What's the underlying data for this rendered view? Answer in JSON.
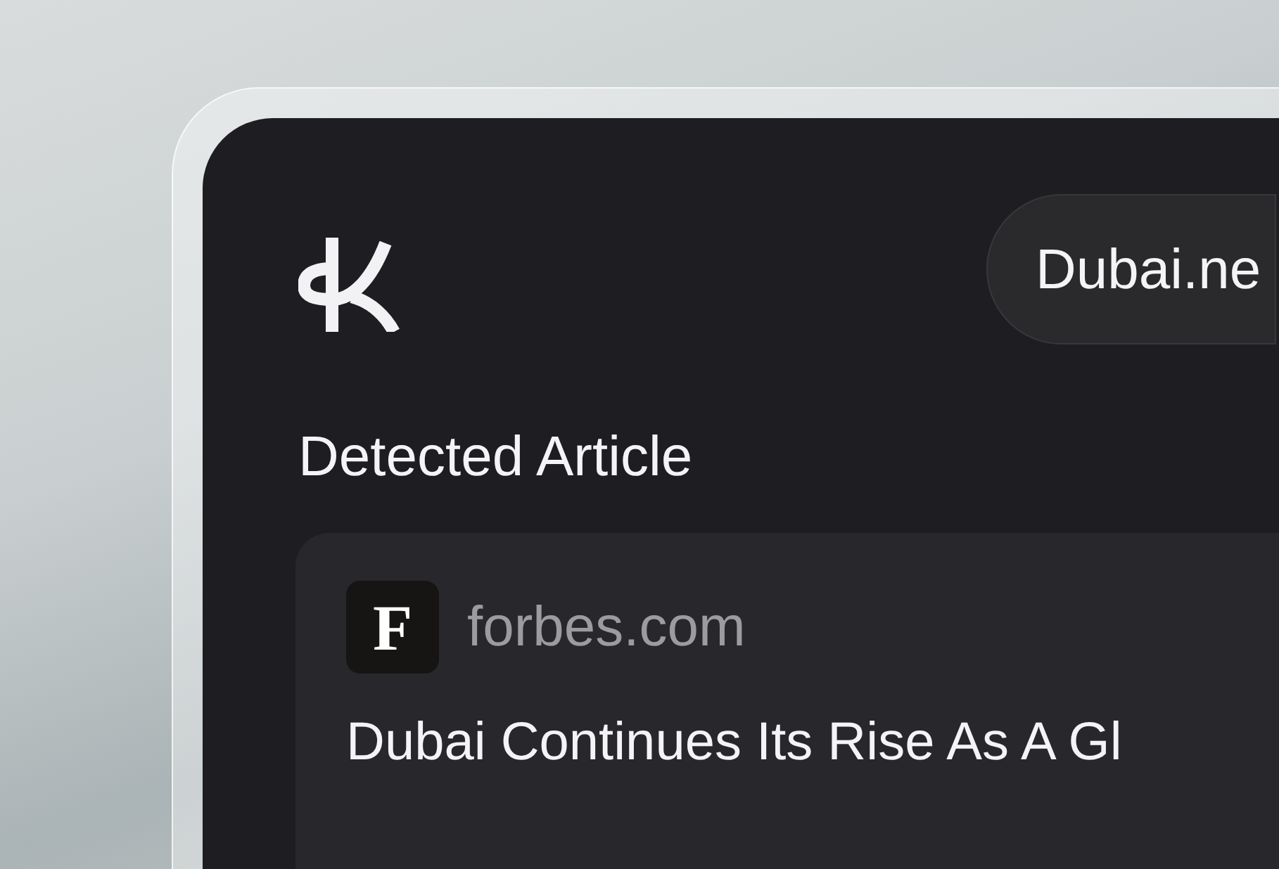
{
  "header": {
    "url_pill": "Dubai.ne"
  },
  "section_title": "Detected Article",
  "article": {
    "source": "forbes.com",
    "source_icon_letter": "F",
    "title": "Dubai Continues Its Rise As A Gl"
  }
}
